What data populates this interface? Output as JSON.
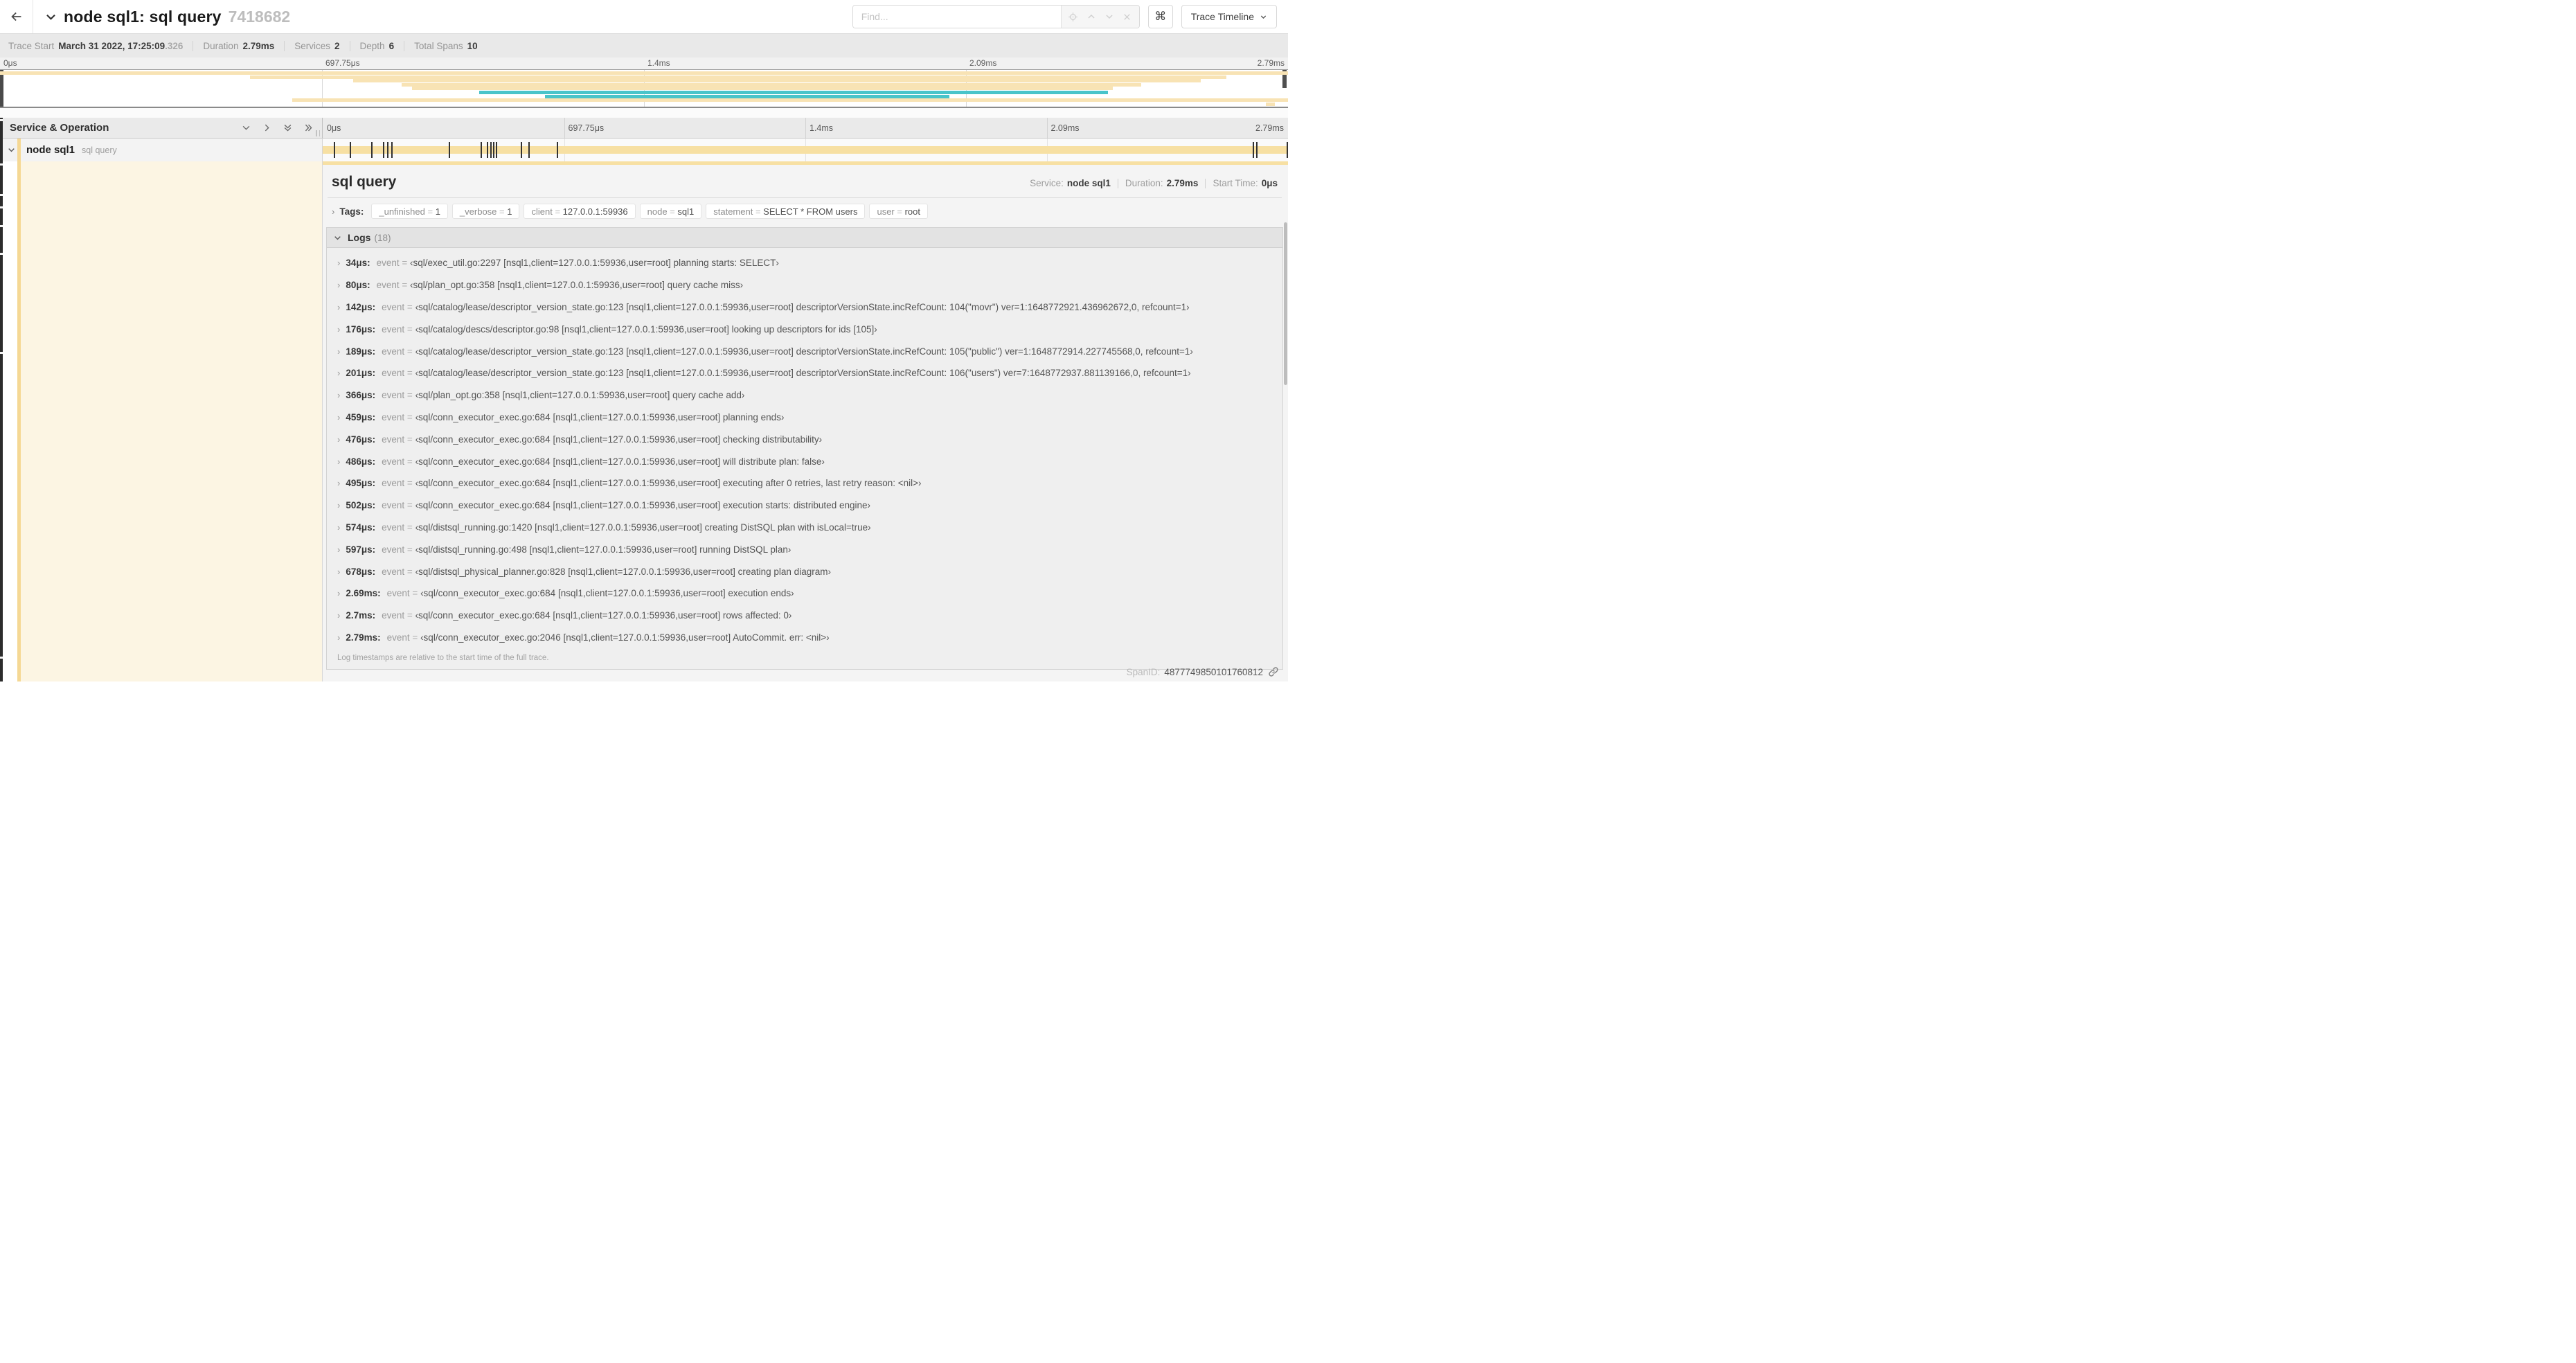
{
  "header": {
    "title": "node sql1: sql query",
    "trace_id_short": "7418682",
    "find_placeholder": "Find...",
    "shortcut_glyph": "⌘",
    "view_selector_label": "Trace Timeline"
  },
  "summary": {
    "trace_start_label": "Trace Start",
    "trace_start_value": "March 31 2022, 17:25:09",
    "trace_start_fraction": ".326",
    "duration_label": "Duration",
    "duration_value": "2.79ms",
    "services_label": "Services",
    "services_value": "2",
    "depth_label": "Depth",
    "depth_value": "6",
    "total_spans_label": "Total Spans",
    "total_spans_value": "10"
  },
  "timeline": {
    "ticks": [
      "0μs",
      "697.75μs",
      "1.4ms",
      "2.09ms",
      "2.79ms"
    ],
    "colors": {
      "span": "#f8e3b4",
      "teal": "#49c4ca"
    },
    "minimap_spans": [
      {
        "color": "tan",
        "start": 0,
        "end": 100
      },
      {
        "color": "tan",
        "start": 19.4,
        "end": 95.2
      },
      {
        "color": "tan",
        "start": 27.4,
        "end": 93.2
      },
      {
        "color": "tan",
        "start": 31.2,
        "end": 88.6
      },
      {
        "color": "tan",
        "start": 32.0,
        "end": 86.4
      },
      {
        "color": "teal",
        "start": 37.2,
        "end": 86.0
      },
      {
        "color": "teal",
        "start": 42.3,
        "end": 73.7
      },
      {
        "color": "tan",
        "start": 22.7,
        "end": 100
      },
      {
        "color": "tan",
        "start": 98.3,
        "end": 99.0
      }
    ],
    "log_marker_pcts": [
      1.22,
      2.87,
      5.09,
      6.31,
      6.77,
      7.2,
      13.12,
      16.45,
      17.06,
      17.42,
      17.74,
      18.0,
      20.57,
      21.4,
      24.3,
      96.42,
      96.77,
      99.9
    ]
  },
  "columns": {
    "service_operation_label": "Service & Operation"
  },
  "row": {
    "service": "node sql1",
    "operation": "sql query"
  },
  "detail": {
    "operation": "sql query",
    "service_label": "Service:",
    "service": "node sql1",
    "duration_label": "Duration:",
    "duration": "2.79ms",
    "start_label": "Start Time:",
    "start": "0μs",
    "tags_label": "Tags:",
    "tags": [
      {
        "key": "_unfinished",
        "value": "1"
      },
      {
        "key": "_verbose",
        "value": "1"
      },
      {
        "key": "client",
        "value": "127.0.0.1:59936"
      },
      {
        "key": "node",
        "value": "sql1"
      },
      {
        "key": "statement",
        "value": "SELECT * FROM users"
      },
      {
        "key": "user",
        "value": "root"
      }
    ],
    "logs_label": "Logs",
    "logs_count": "(18)",
    "logs": [
      {
        "time": "34μs:",
        "key": "event",
        "value": "‹sql/exec_util.go:2297 [nsql1,client=127.0.0.1:59936,user=root] planning starts: SELECT›"
      },
      {
        "time": "80μs:",
        "key": "event",
        "value": "‹sql/plan_opt.go:358 [nsql1,client=127.0.0.1:59936,user=root] query cache miss›"
      },
      {
        "time": "142μs:",
        "key": "event",
        "value": "‹sql/catalog/lease/descriptor_version_state.go:123 [nsql1,client=127.0.0.1:59936,user=root] descriptorVersionState.incRefCount: 104(\"movr\") ver=1:1648772921.436962672,0, refcount=1›"
      },
      {
        "time": "176μs:",
        "key": "event",
        "value": "‹sql/catalog/descs/descriptor.go:98 [nsql1,client=127.0.0.1:59936,user=root] looking up descriptors for ids [105]›"
      },
      {
        "time": "189μs:",
        "key": "event",
        "value": "‹sql/catalog/lease/descriptor_version_state.go:123 [nsql1,client=127.0.0.1:59936,user=root] descriptorVersionState.incRefCount: 105(\"public\") ver=1:1648772914.227745568,0, refcount=1›"
      },
      {
        "time": "201μs:",
        "key": "event",
        "value": "‹sql/catalog/lease/descriptor_version_state.go:123 [nsql1,client=127.0.0.1:59936,user=root] descriptorVersionState.incRefCount: 106(\"users\") ver=7:1648772937.881139166,0, refcount=1›"
      },
      {
        "time": "366μs:",
        "key": "event",
        "value": "‹sql/plan_opt.go:358 [nsql1,client=127.0.0.1:59936,user=root] query cache add›"
      },
      {
        "time": "459μs:",
        "key": "event",
        "value": "‹sql/conn_executor_exec.go:684 [nsql1,client=127.0.0.1:59936,user=root] planning ends›"
      },
      {
        "time": "476μs:",
        "key": "event",
        "value": "‹sql/conn_executor_exec.go:684 [nsql1,client=127.0.0.1:59936,user=root] checking distributability›"
      },
      {
        "time": "486μs:",
        "key": "event",
        "value": "‹sql/conn_executor_exec.go:684 [nsql1,client=127.0.0.1:59936,user=root] will distribute plan: false›"
      },
      {
        "time": "495μs:",
        "key": "event",
        "value": "‹sql/conn_executor_exec.go:684 [nsql1,client=127.0.0.1:59936,user=root] executing after 0 retries, last retry reason: <nil>›"
      },
      {
        "time": "502μs:",
        "key": "event",
        "value": "‹sql/conn_executor_exec.go:684 [nsql1,client=127.0.0.1:59936,user=root] execution starts: distributed engine›"
      },
      {
        "time": "574μs:",
        "key": "event",
        "value": "‹sql/distsql_running.go:1420 [nsql1,client=127.0.0.1:59936,user=root] creating DistSQL plan with isLocal=true›"
      },
      {
        "time": "597μs:",
        "key": "event",
        "value": "‹sql/distsql_running.go:498 [nsql1,client=127.0.0.1:59936,user=root] running DistSQL plan›"
      },
      {
        "time": "678μs:",
        "key": "event",
        "value": "‹sql/distsql_physical_planner.go:828 [nsql1,client=127.0.0.1:59936,user=root] creating plan diagram›"
      },
      {
        "time": "2.69ms:",
        "key": "event",
        "value": "‹sql/conn_executor_exec.go:684 [nsql1,client=127.0.0.1:59936,user=root] execution ends›"
      },
      {
        "time": "2.7ms:",
        "key": "event",
        "value": "‹sql/conn_executor_exec.go:684 [nsql1,client=127.0.0.1:59936,user=root] rows affected: 0›"
      },
      {
        "time": "2.79ms:",
        "key": "event",
        "value": "‹sql/conn_executor_exec.go:2046 [nsql1,client=127.0.0.1:59936,user=root] AutoCommit. err: <nil>›"
      }
    ],
    "footer_note": "Log timestamps are relative to the start time of the full trace.",
    "span_id_label": "SpanID:",
    "span_id": "4877749850101760812"
  }
}
